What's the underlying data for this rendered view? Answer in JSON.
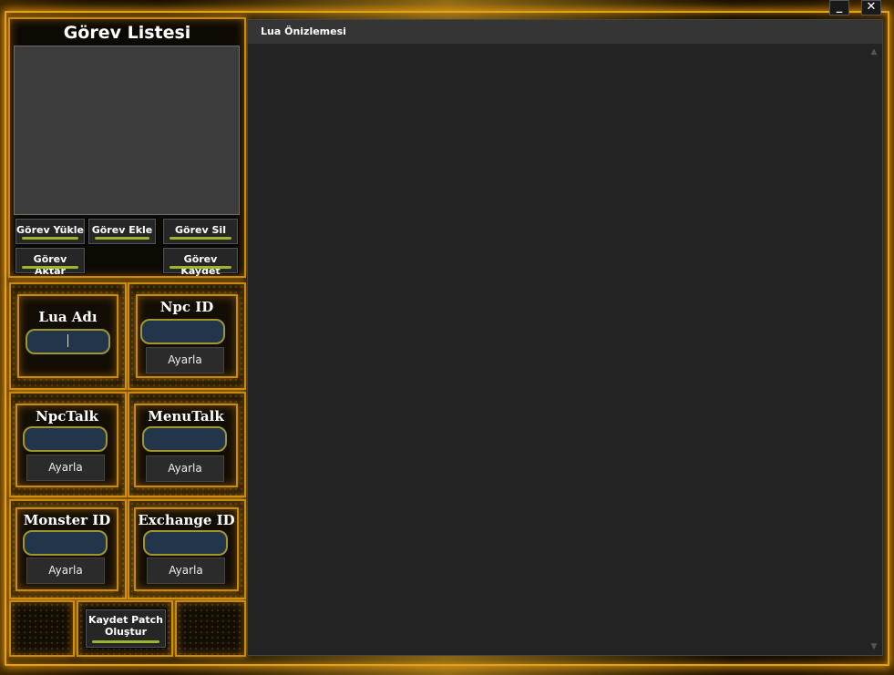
{
  "window": {
    "minimize_label": "_",
    "close_label": "✕"
  },
  "quest_list": {
    "title": "Görev Listesi",
    "buttons": {
      "load": "Görev Yükle",
      "add": "Görev Ekle",
      "delete": "Görev Sil",
      "transfer": "Görev Aktar",
      "save": "Görev Kaydet"
    }
  },
  "fields": {
    "lua_name": {
      "title": "Lua Adı",
      "value": ""
    },
    "npc_id": {
      "title": "Npc ID",
      "value": "",
      "button": "Ayarla"
    },
    "npc_talk": {
      "title": "NpcTalk",
      "value": "",
      "button": "Ayarla"
    },
    "menu_talk": {
      "title": "MenuTalk",
      "value": "",
      "button": "Ayarla"
    },
    "monster_id": {
      "title": "Monster ID",
      "value": "",
      "button": "Ayarla"
    },
    "exchange_id": {
      "title": "Exchange ID",
      "value": "",
      "button": "Ayarla"
    }
  },
  "save_patch": {
    "line1": "Kaydet  Patch",
    "line2": "Oluştur"
  },
  "preview": {
    "title": "Lua Önizlemesi",
    "content": ""
  },
  "colors": {
    "accent_gold": "#e3a11a",
    "button_underline": "#9db52b",
    "input_bg": "#23354a",
    "input_border": "#a0962a"
  },
  "icons": {
    "scroll_up": "▲",
    "scroll_down": "▼"
  }
}
